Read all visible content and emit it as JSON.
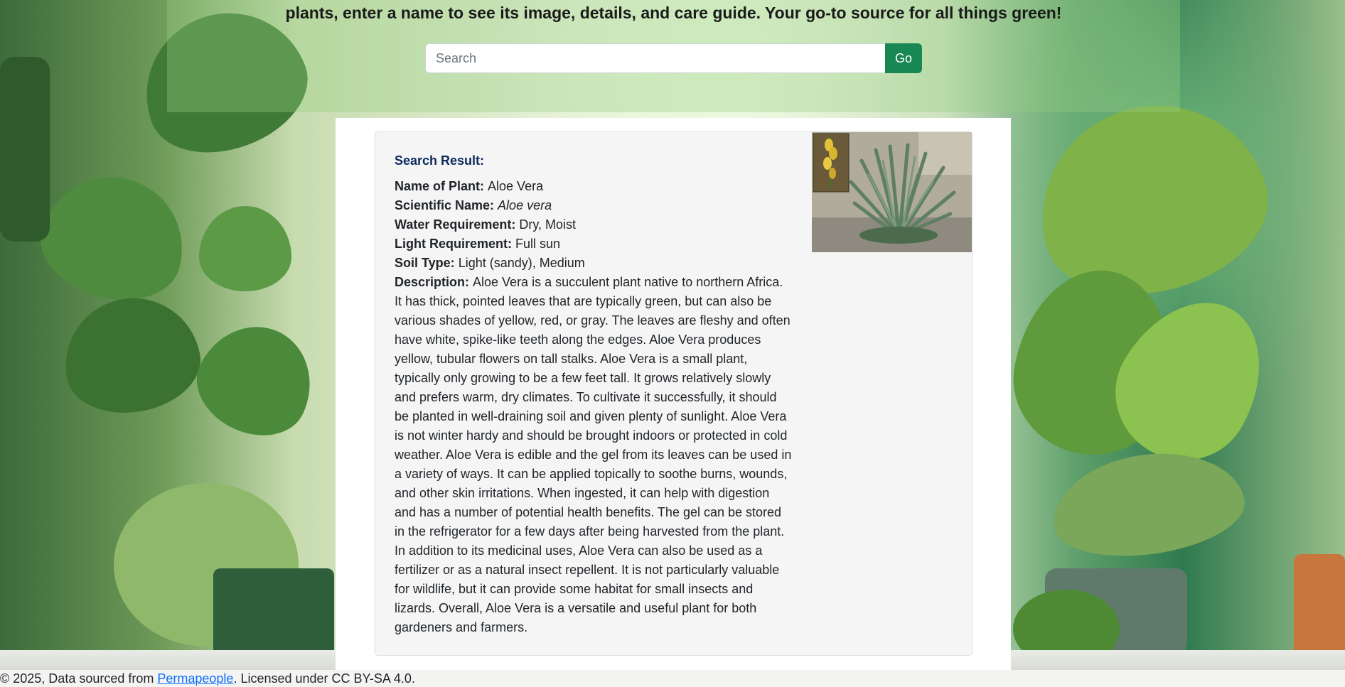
{
  "header": {
    "tagline": "plants, enter a name to see its image, details, and care guide. Your go-to source for all things green!"
  },
  "search": {
    "placeholder": "Search",
    "value": "",
    "button_label": "Go"
  },
  "result": {
    "heading": "Search Result:",
    "fields": {
      "name_label": "Name of Plant:",
      "name_value": "Aloe Vera",
      "scientific_label": "Scientific Name:",
      "scientific_value": "Aloe vera",
      "water_label": "Water Requirement:",
      "water_value": "Dry, Moist",
      "light_label": "Light Requirement:",
      "light_value": "Full sun",
      "soil_label": "Soil Type:",
      "soil_value": "Light (sandy), Medium",
      "description_label": "Description:",
      "description_value": "Aloe Vera is a succulent plant native to northern Africa. It has thick, pointed leaves that are typically green, but can also be various shades of yellow, red, or gray. The leaves are fleshy and often have white, spike-like teeth along the edges. Aloe Vera produces yellow, tubular flowers on tall stalks. Aloe Vera is a small plant, typically only growing to be a few feet tall. It grows relatively slowly and prefers warm, dry climates. To cultivate it successfully, it should be planted in well-draining soil and given plenty of sunlight. Aloe Vera is not winter hardy and should be brought indoors or protected in cold weather. Aloe Vera is edible and the gel from its leaves can be used in a variety of ways. It can be applied topically to soothe burns, wounds, and other skin irritations. When ingested, it can help with digestion and has a number of potential health benefits. The gel can be stored in the refrigerator for a few days after being harvested from the plant. In addition to its medicinal uses, Aloe Vera can also be used as a fertilizer or as a natural insect repellent. It is not particularly valuable for wildlife, but it can provide some habitat for small insects and lizards. Overall, Aloe Vera is a versatile and useful plant for both gardeners and farmers."
    }
  },
  "footer": {
    "prefix": "© 2025, Data sourced from ",
    "link_text": "Permapeople",
    "suffix": ". Licensed under CC BY-SA 4.0."
  },
  "colors": {
    "go_button": "#198754",
    "result_heading": "#0d2a5c",
    "link": "#0d6efd"
  }
}
